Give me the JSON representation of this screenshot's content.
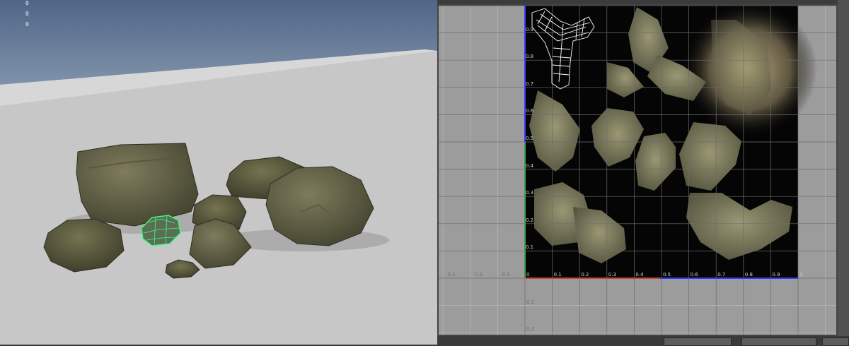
{
  "viewport": {
    "hud_lines": [
      "0",
      "0",
      "0"
    ]
  },
  "uv_editor": {
    "u_ticks": [
      "0",
      "0.1",
      "0.2",
      "0.3",
      "0.4",
      "0.5",
      "0.6",
      "0.7",
      "0.8",
      "0.9",
      "1"
    ],
    "v_ticks": [
      "0.9",
      "0.8",
      "0.7",
      "0.6",
      "0.5",
      "0.4",
      "0.3",
      "0.2",
      "0.1"
    ],
    "neg_u_ticks": [
      "0.3",
      "0.2",
      "0.1"
    ],
    "neg_v_ticks": [
      "0.1",
      "0.2"
    ]
  },
  "colors": {
    "selection": "#3cff7a",
    "u_axis": "#d04040",
    "v_axis": "#3aa050",
    "uv_border": "#3a3aff"
  }
}
